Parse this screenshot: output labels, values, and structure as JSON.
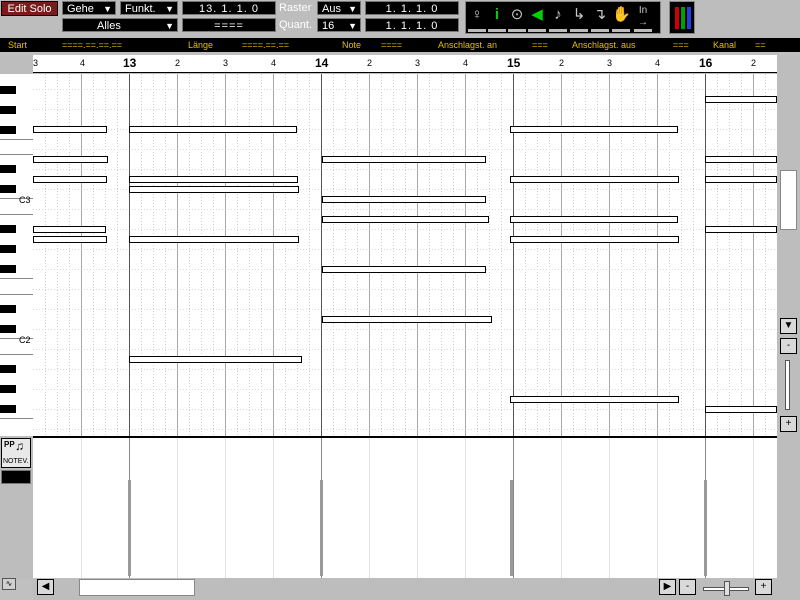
{
  "toolbar": {
    "edit_solo": "Edit Solo",
    "goto_label": "Gehe",
    "function_label": "Funkt.",
    "position_display": "13. 1. 1. 0",
    "raster_label": "Raster",
    "raster_value": "Aus",
    "raster_display": "1. 1. 1. 0",
    "filter_label": "Alles",
    "blank_display": "====",
    "quant_label": "Quant.",
    "quant_value": "16",
    "quant_display": "1. 1. 1. 0",
    "tool_icons": [
      "loop-icon",
      "info-icon",
      "mute-icon",
      "speaker-icon",
      "note-icon",
      "step-icon",
      "split-icon",
      "hand-icon",
      "in-out-icon"
    ],
    "in_label": "In"
  },
  "info_line": {
    "start_label": "Start",
    "start_value": "====.==.==.==",
    "length_label": "Länge",
    "length_value": "====.==.==",
    "note_label": "Note",
    "note_value": "====",
    "vel_on_label": "Anschlagst. an",
    "vel_on_value": "===",
    "vel_off_label": "Anschlagst. aus",
    "vel_off_value": "===",
    "channel_label": "Kanal",
    "channel_value": "=="
  },
  "ruler": {
    "ticks": [
      "3",
      "4",
      "13",
      "2",
      "3",
      "4",
      "14",
      "2",
      "3",
      "4",
      "15",
      "2",
      "3",
      "4",
      "16",
      "2"
    ]
  },
  "keyboard": {
    "labels": [
      "C3",
      "C2"
    ]
  },
  "velocity": {
    "button_label": "NOTEV.",
    "dynamic_label": "PP"
  },
  "scroll": {
    "up": "▲",
    "down": "▼",
    "minus": "-",
    "plus": "+",
    "left": "◀",
    "right": "▶"
  }
}
